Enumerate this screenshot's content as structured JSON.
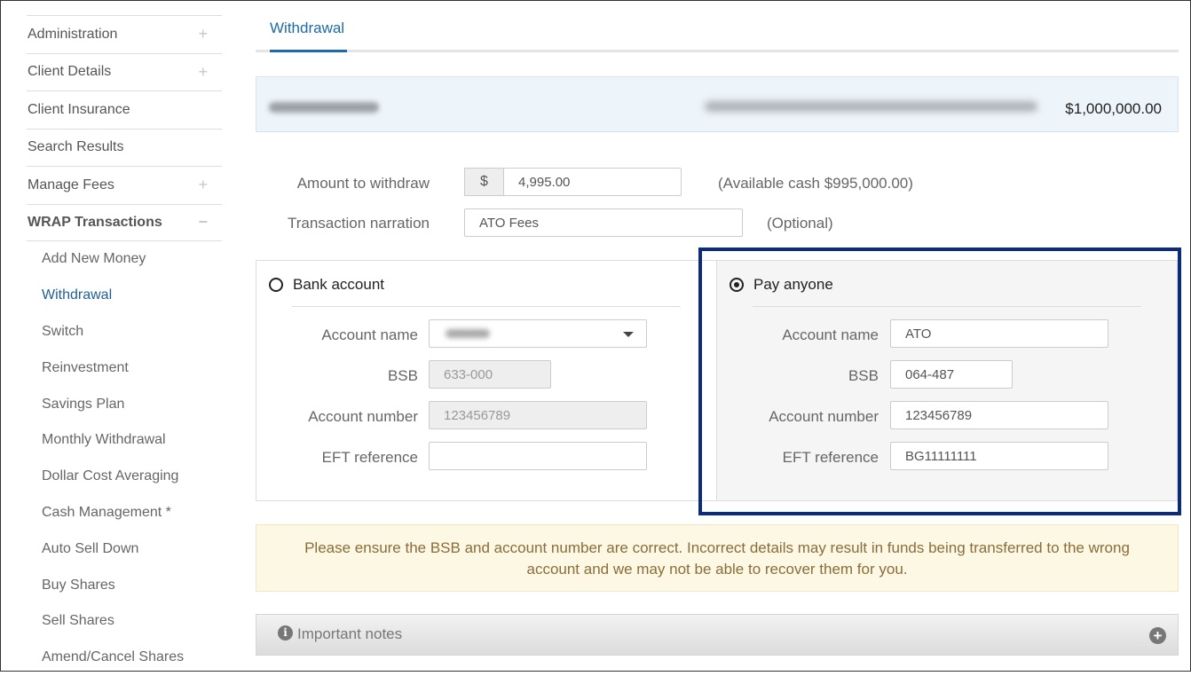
{
  "sidebar": {
    "items": [
      {
        "label": "Administration",
        "toggle": "+"
      },
      {
        "label": "Client Details",
        "toggle": "+"
      },
      {
        "label": "Client Insurance",
        "toggle": ""
      },
      {
        "label": "Search Results",
        "toggle": ""
      },
      {
        "label": "Manage Fees",
        "toggle": "+"
      },
      {
        "label": "WRAP Transactions",
        "toggle": "−"
      }
    ],
    "sub_items": [
      "Add New Money",
      "Withdrawal",
      "Switch",
      "Reinvestment",
      "Savings Plan",
      "Monthly Withdrawal",
      "Dollar Cost Averaging",
      "Cash Management *",
      "Auto Sell Down",
      "Buy Shares",
      "Sell Shares",
      "Amend/Cancel Shares"
    ]
  },
  "tabs": {
    "active": "Withdrawal"
  },
  "account": {
    "balance": "$1,000,000.00"
  },
  "form": {
    "amount_label": "Amount to withdraw",
    "currency_symbol": "$",
    "amount_value": "4,995.00",
    "available_cash": "(Available cash $995,000.00)",
    "narration_label": "Transaction narration",
    "narration_value": "ATO Fees",
    "narration_hint": "(Optional)"
  },
  "bank_account": {
    "title": "Bank account",
    "account_name_label": "Account name",
    "bsb_label": "BSB",
    "bsb_value": "633-000",
    "account_number_label": "Account number",
    "account_number_value": "123456789",
    "eft_label": "EFT reference",
    "eft_value": ""
  },
  "pay_anyone": {
    "title": "Pay anyone",
    "account_name_label": "Account name",
    "account_name_value": "ATO",
    "bsb_label": "BSB",
    "bsb_value": "064-487",
    "account_number_label": "Account number",
    "account_number_value": "123456789",
    "eft_label": "EFT reference",
    "eft_value": "BG11111111"
  },
  "warning": {
    "line1": "Please ensure the BSB and account number are correct. Incorrect details may result in funds being transferred to the wrong",
    "line2": "account and we may not be able to recover them for you."
  },
  "notes": {
    "label": "Important notes"
  },
  "colors": {
    "link": "#1f6aa5",
    "highlight_border": "#0b2b80",
    "warning_bg": "#fcf8e3",
    "warning_text": "#8a6d3b"
  }
}
